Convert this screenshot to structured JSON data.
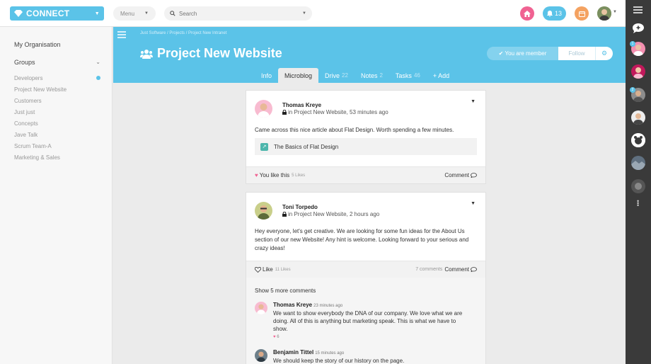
{
  "topbar": {
    "brand": "CONNECT",
    "menu_label": "Menu",
    "search_placeholder": "Search",
    "notifications_count": "13"
  },
  "sidebar": {
    "organisation": "My Organisation",
    "groups_label": "Groups",
    "groups": [
      "Developers",
      "Project New Website",
      "Customers",
      "Just just",
      "Concepts",
      "Jave Talk",
      "Scrum Team-A",
      "Marketing & Sales"
    ]
  },
  "header": {
    "breadcrumb": "Just Software  /  Projects  /  Project New Intranet",
    "title": "Project New Website",
    "member_label": "You are member",
    "follow_label": "Follow",
    "tabs": [
      {
        "label": "Info",
        "count": ""
      },
      {
        "label": "Microblog",
        "count": ""
      },
      {
        "label": "Drive",
        "count": "22"
      },
      {
        "label": "Notes",
        "count": "2"
      },
      {
        "label": "Tasks",
        "count": "46"
      },
      {
        "label": "+ Add",
        "count": ""
      }
    ]
  },
  "posts": [
    {
      "author": "Thomas Kreye",
      "meta": "in Project New Website, 53 minutes ago",
      "body": "Came across this nice article about Flat Design. Worth spending a few minutes.",
      "link_title": "The Basics of Flat Design",
      "like_label": "You like this",
      "like_count": "5 Likes",
      "comment_label": "Comment"
    },
    {
      "author": "Toni Torpedo",
      "meta": "in Project New Website, 2 hours ago",
      "body": "Hey everyone, let's get creative. We are looking for some fun ideas for the About Us section of our new Website! Any hint is welcome. Looking forward to your serious and crazy ideas!",
      "like_label": "Like",
      "like_count": "11 Likes",
      "comments_count": "7 comments",
      "comment_label": "Comment",
      "show_more": "Show 5 more comments",
      "comments": [
        {
          "author": "Thomas Kreye",
          "time": "23 minutes ago",
          "body": "We want to show everybody the DNA of our company. We love what we are doing. All of this is anything but marketing speak. This is what we have to show.",
          "likes": "6"
        },
        {
          "author": "Benjamin Tittel",
          "time": "15 minutes ago",
          "body": "We should keep the story of our history on the page."
        }
      ]
    }
  ],
  "rail": {
    "badges": [
      "1",
      "2"
    ]
  }
}
